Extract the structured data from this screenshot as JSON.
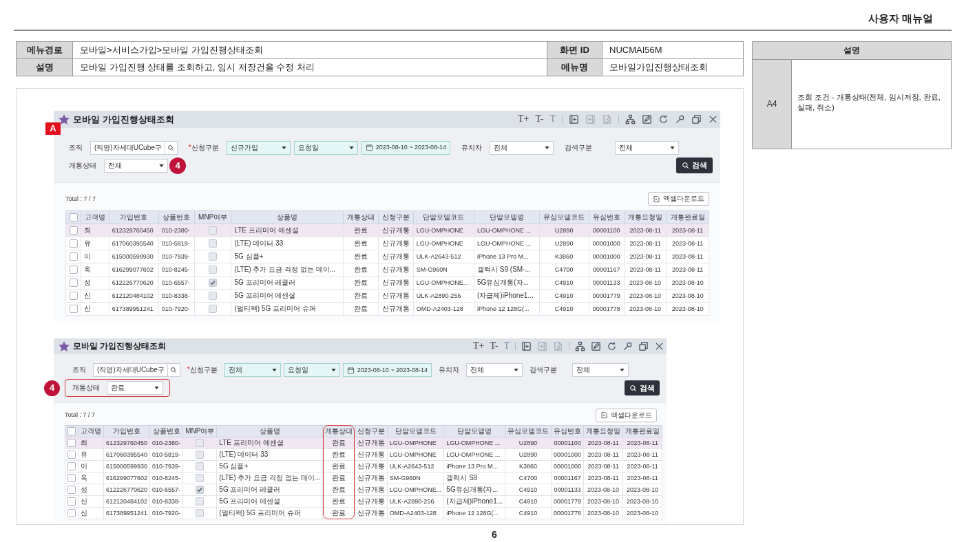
{
  "header": {
    "title": "사용자 매뉴얼"
  },
  "info_table": {
    "rows": [
      {
        "label": "메뉴경로",
        "value": "모바일>서비스가입>모바일 가입진행상태조회",
        "label_2": "화면 ID",
        "value_2": "NUCMAI56M"
      },
      {
        "label": "설명",
        "value": "모바일 가입진행 상태를 조회하고, 임시 저장건을 수정 처리",
        "label_2": "메뉴명",
        "value_2": "모바일가입진행상태조회"
      }
    ]
  },
  "description_panel": {
    "heading": "설명",
    "items": [
      {
        "code": "A4",
        "text": "조회 조건 - 개통상태(전체, 임시저장, 완료, 실패, 취소)"
      }
    ]
  },
  "screenshots": [
    {
      "badge": "A",
      "title": "모바일 가입진행상태조회",
      "text_tools": [
        {
          "label": "T+",
          "disabled": false
        },
        {
          "label": "T-",
          "disabled": false
        },
        {
          "label": "T",
          "disabled": true
        }
      ],
      "icon_tools": [
        {
          "disabled": false
        },
        {
          "disabled": true
        },
        {
          "disabled": true
        },
        {
          "disabled": false
        },
        {
          "disabled": false
        },
        {
          "disabled": false
        },
        {
          "disabled": false
        },
        {
          "disabled": false
        },
        {
          "disabled": false
        }
      ],
      "filter_rows": [
        [
          {
            "label": "조직",
            "outlined": false,
            "controls": [
              {
                "kind": "search",
                "value": "(직영)자세대UCube구",
                "required": false
              }
            ]
          },
          {
            "label": "신청구분",
            "mark": "*",
            "outlined": false,
            "controls": [
              {
                "kind": "select",
                "value": "신규가입",
                "required": true
              },
              {
                "kind": "select",
                "value": "요청일",
                "required": true
              },
              {
                "kind": "date",
                "value": "2023-08-10 ~ 2023-08-14",
                "required": true
              }
            ]
          },
          {
            "label": "유치자",
            "outlined": false,
            "controls": [
              {
                "kind": "select",
                "value": "전체",
                "required": false
              }
            ]
          },
          {
            "label": "검색구분",
            "outlined": false,
            "controls": [
              {
                "kind": "select",
                "value": "전체",
                "required": false
              }
            ]
          }
        ],
        [
          {
            "label": "개통상태",
            "marker": "4",
            "outlined": false,
            "controls": [
              {
                "kind": "select",
                "value": "전체",
                "required": false
              }
            ]
          }
        ]
      ],
      "search_button": "검색",
      "total": "Total : 7 / 7",
      "excel_button": "엑셀다운로드",
      "all_checked": false,
      "columns": [
        {
          "label": "고객명",
          "kind": "text",
          "outlined": false
        },
        {
          "label": "가입번호",
          "kind": "text",
          "outlined": false
        },
        {
          "label": "상품번호",
          "kind": "text",
          "outlined": false
        },
        {
          "label": "MNP여부",
          "kind": "check",
          "outlined": false
        },
        {
          "label": "상품명",
          "kind": "text",
          "outlined": false
        },
        {
          "label": "개통상태",
          "kind": "text",
          "outlined": false
        },
        {
          "label": "신청구분",
          "kind": "text",
          "outlined": false
        },
        {
          "label": "단말모델코드",
          "kind": "text",
          "outlined": false
        },
        {
          "label": "단말모델명",
          "kind": "text",
          "outlined": false
        },
        {
          "label": "유심모델코드",
          "kind": "text",
          "outlined": false
        },
        {
          "label": "유심번호",
          "kind": "text",
          "outlined": false
        },
        {
          "label": "개통요청일",
          "kind": "text",
          "outlined": false
        },
        {
          "label": "개통완료일",
          "kind": "text",
          "outlined": false
        }
      ],
      "rows": [
        {
          "selected": true,
          "checked": false,
          "mnp": false,
          "cells": [
            "최",
            "612329760450",
            "010-2380-",
            "",
            "LTE 프리미어 에센셜",
            "완료",
            "신규개통",
            "LGU-OMPHONE",
            "LGU-OMPHONE ...",
            "U2890",
            "00001100",
            "2023-08-11",
            "2023-08-11"
          ]
        },
        {
          "selected": false,
          "checked": false,
          "mnp": false,
          "cells": [
            "유",
            "617060395540",
            "010-5819-",
            "",
            "(LTE) 데이터 33",
            "완료",
            "신규개통",
            "LGU-OMPHONE",
            "LGU-OMPHONE ...",
            "U2890",
            "00001000",
            "2023-08-11",
            "2023-08-11"
          ]
        },
        {
          "selected": false,
          "checked": false,
          "mnp": false,
          "cells": [
            "이",
            "615000599930",
            "010-7939-",
            "",
            "5G 심플+",
            "완료",
            "신규개통",
            "ULK-A2643-512",
            "iPhone 13 Pro M...",
            "K3860",
            "00001000",
            "2023-08-11",
            "2023-08-11"
          ]
        },
        {
          "selected": false,
          "checked": false,
          "mnp": false,
          "cells": [
            "옥",
            "616299077602",
            "010-8245-",
            "",
            "(LTE) 추가 요금 걱정 없는 데이...",
            "완료",
            "신규개통",
            "SM-G960N",
            "갤럭시 S9 (SM-...",
            "C4700",
            "00001167",
            "2023-08-11",
            "2023-08-11"
          ]
        },
        {
          "selected": false,
          "checked": false,
          "mnp": true,
          "cells": [
            "성",
            "612226770620",
            "010-6557-",
            "",
            "5G 프리미어 레귤러",
            "완료",
            "신규개통",
            "LGU-OMPHONE...",
            "5G유심개통(자...",
            "C4910",
            "00001133",
            "2023-08-10",
            "2023-08-10"
          ]
        },
        {
          "selected": false,
          "checked": false,
          "mnp": false,
          "cells": [
            "신",
            "612120484102",
            "010-8338-",
            "",
            "5G 프리미어 에센셜",
            "완료",
            "신규개통",
            "ULK-A2890-256",
            "(자급제)iPhone1...",
            "C4910",
            "00001779",
            "2023-08-10",
            "2023-08-10"
          ]
        },
        {
          "selected": false,
          "checked": false,
          "mnp": false,
          "cells": [
            "신",
            "617389951241",
            "010-7920-",
            "",
            "(멀티팩) 5G 프리미어 슈퍼",
            "완료",
            "신규개통",
            "OMD-A2403-128",
            "iPhone 12 128G(...",
            "C4910",
            "00001778",
            "2023-08-10",
            "2023-08-10"
          ]
        }
      ]
    },
    {
      "title": "모바일 가입진행상태조회",
      "text_tools": [
        {
          "label": "T+",
          "disabled": false
        },
        {
          "label": "T-",
          "disabled": false
        },
        {
          "label": "T",
          "disabled": true
        }
      ],
      "icon_tools": [
        {
          "disabled": false
        },
        {
          "disabled": true
        },
        {
          "disabled": true
        },
        {
          "disabled": false
        },
        {
          "disabled": false
        },
        {
          "disabled": false
        },
        {
          "disabled": false
        },
        {
          "disabled": false
        },
        {
          "disabled": false
        }
      ],
      "filter_rows": [
        [
          {
            "label": "조직",
            "outlined": false,
            "controls": [
              {
                "kind": "search",
                "value": "(직영)자세대UCube구",
                "required": false
              }
            ]
          },
          {
            "label": "신청구분",
            "mark": "*",
            "outlined": false,
            "controls": [
              {
                "kind": "select",
                "value": "전체",
                "required": true
              },
              {
                "kind": "select",
                "value": "요청일",
                "required": true
              },
              {
                "kind": "date",
                "value": "2023-08-10 ~ 2023-08-14",
                "required": true
              }
            ]
          },
          {
            "label": "유치자",
            "outlined": false,
            "controls": [
              {
                "kind": "select",
                "value": "전체",
                "required": false
              }
            ]
          },
          {
            "label": "검색구분",
            "outlined": false,
            "controls": [
              {
                "kind": "select",
                "value": "전체",
                "required": false
              }
            ]
          }
        ],
        [
          {
            "label": "개통상태",
            "marker": "4",
            "outlined": true,
            "controls": [
              {
                "kind": "select",
                "value": "완료",
                "required": false
              }
            ]
          }
        ]
      ],
      "search_button": "검색",
      "total": "Total : 7 / 7",
      "excel_button": "엑셀다운로드",
      "all_checked": false,
      "columns": [
        {
          "label": "고객명",
          "kind": "text",
          "outlined": false
        },
        {
          "label": "가입번호",
          "kind": "text",
          "outlined": false
        },
        {
          "label": "상품번호",
          "kind": "text",
          "outlined": false
        },
        {
          "label": "MNP여부",
          "kind": "check",
          "outlined": false
        },
        {
          "label": "상품명",
          "kind": "text",
          "outlined": false
        },
        {
          "label": "개통상태",
          "kind": "text",
          "outlined": true
        },
        {
          "label": "신청구분",
          "kind": "text",
          "outlined": false
        },
        {
          "label": "단말모델코드",
          "kind": "text",
          "outlined": false
        },
        {
          "label": "단말모델명",
          "kind": "text",
          "outlined": false
        },
        {
          "label": "유심모델코드",
          "kind": "text",
          "outlined": false
        },
        {
          "label": "유심번호",
          "kind": "text",
          "outlined": false
        },
        {
          "label": "개통요청일",
          "kind": "text",
          "outlined": false
        },
        {
          "label": "개통완료일",
          "kind": "text",
          "outlined": false
        }
      ],
      "rows": [
        {
          "selected": true,
          "checked": false,
          "mnp": false,
          "cells": [
            "최",
            "612329760450",
            "010-2380-",
            "",
            "LTE 프리미어 에센셜",
            "완료",
            "신규개통",
            "LGU-OMPHONE",
            "LGU-OMPHONE ...",
            "U2890",
            "00001100",
            "2023-08-11",
            "2023-08-11"
          ]
        },
        {
          "selected": false,
          "checked": false,
          "mnp": false,
          "cells": [
            "유",
            "617060395540",
            "010-5819-",
            "",
            "(LTE) 데이터 33",
            "완료",
            "신규개통",
            "LGU-OMPHONE",
            "LGU-OMPHONE ...",
            "U2890",
            "00001000",
            "2023-08-11",
            "2023-08-11"
          ]
        },
        {
          "selected": false,
          "checked": false,
          "mnp": false,
          "cells": [
            "이",
            "615000599930",
            "010-7939-",
            "",
            "5G 심플+",
            "완료",
            "신규개통",
            "ULK-A2643-512",
            "iPhone 13 Pro M...",
            "K3860",
            "00001000",
            "2023-08-11",
            "2023-08-11"
          ]
        },
        {
          "selected": false,
          "checked": false,
          "mnp": false,
          "cells": [
            "옥",
            "616299077602",
            "010-8245-",
            "",
            "(LTE) 추가 요금 걱정 없는 데이...",
            "완료",
            "신규개통",
            "SM-G960N",
            "갤럭시 S9",
            "C4700",
            "00001167",
            "2023-08-11",
            "2023-08-11"
          ]
        },
        {
          "selected": false,
          "checked": false,
          "mnp": true,
          "cells": [
            "성",
            "612226770620",
            "010-6557-",
            "",
            "5G 프리미어 레귤러",
            "완료",
            "신규개통",
            "LGU-OMPHONE...",
            "5G유심개통(자...",
            "C4910",
            "00001133",
            "2023-08-10",
            "2023-08-10"
          ]
        },
        {
          "selected": false,
          "checked": false,
          "mnp": false,
          "cells": [
            "신",
            "612120484102",
            "010-8338-",
            "",
            "5G 프리미어 에센셜",
            "완료",
            "신규개통",
            "ULK-A2890-256",
            "(자급제)iPhone1...",
            "C4910",
            "00001779",
            "2023-08-10",
            "2023-08-10"
          ]
        },
        {
          "selected": false,
          "checked": false,
          "mnp": false,
          "cells": [
            "신",
            "617389951241",
            "010-7920-",
            "",
            "(멀티팩) 5G 프리미어 슈퍼",
            "완료",
            "신규개통",
            "OMD-A2403-128",
            "iPhone 12 128G(...",
            "C4910",
            "00001778",
            "2023-08-10",
            "2023-08-10"
          ]
        }
      ]
    }
  ],
  "page_number": "6"
}
